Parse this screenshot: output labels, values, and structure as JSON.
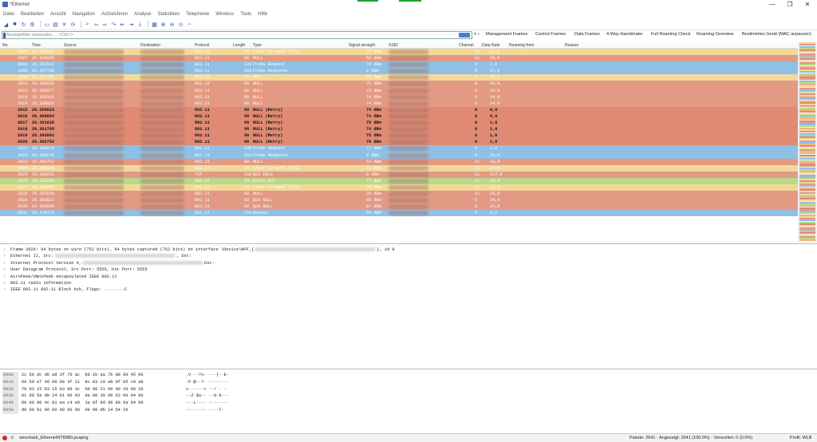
{
  "window": {
    "title": "*Ethernet",
    "minimize": "—",
    "maximize": "❐",
    "close": "✕"
  },
  "menu": [
    "Datei",
    "Bearbeiten",
    "Ansicht",
    "Navigation",
    "Aufzeichnen",
    "Analyse",
    "Statistiken",
    "Telephonie",
    "Wireless",
    "Tools",
    "Hilfe"
  ],
  "toolbar_icons": [
    "shark-fin-start-icon",
    "stop-icon",
    "restart-icon",
    "options-gear-icon",
    "open-file-icon",
    "save-icon",
    "close-file-icon",
    "reload-icon",
    "find-icon",
    "back-arrow-icon",
    "forward-arrow-icon",
    "goto-packet-icon",
    "first-packet-icon",
    "last-packet-icon",
    "autoscroll-icon",
    "colorize-icon",
    "zoom-in-icon",
    "zoom-out-icon",
    "zoom-normal-icon",
    "resize-columns-icon"
  ],
  "filter": {
    "placeholder": "Anzeigefilter anwenden … <Ctrl-/>",
    "buttons": [
      "Management Frames",
      "Control Frames",
      "Data Frames",
      "4-Way-Handshake",
      "Full Roaming Check",
      "Roaming Overview",
      "Bestimmtes Gerät (MAC anpassen)"
    ]
  },
  "columns": [
    "No.",
    "Time",
    "Source",
    "Destination",
    "Protocol",
    "Length",
    "Type",
    "Signal strength",
    "SSID",
    "Channel",
    "Data Rate",
    "Roaming from",
    "Reason"
  ],
  "colors": {
    "yellow": "#f2d99a",
    "salmon": "#e39a84",
    "blue": "#8fc0e6",
    "green": "#b9d98a",
    "orange": "#f0b483",
    "dark_salmon": "#e08a74"
  },
  "packets": [
    {
      "no": "2006",
      "time": "26.338021",
      "proto": "802.11",
      "len": "70",
      "type": "Clear-to-send (CTS)",
      "sig": "77 dBm",
      "ch": "11",
      "rate": "11,0",
      "color": "#f2d99a",
      "bold": false
    },
    {
      "no": "2007",
      "time": "26.338025",
      "proto": "802.11",
      "len": "90",
      "type": "NULL",
      "sig": "52 dBm",
      "ch": "11",
      "rate": "18,0",
      "color": "#e39a84",
      "bold": false
    },
    {
      "no": "2008",
      "time": "26.357614",
      "proto": "802.11",
      "len": "231",
      "type": "Probe Request",
      "sig": "76 dBm",
      "ch": "6",
      "rate": "1,0",
      "color": "#8fc0e6",
      "bold": false
    },
    {
      "no": "2009",
      "time": "26.357798",
      "proto": "802.11",
      "len": "203",
      "type": "Probe Response",
      "sig": "0 dBm",
      "ch": "6",
      "rate": "24,0",
      "color": "#8fc0e6",
      "bold": false
    },
    {
      "no": "2010",
      "time": "26.357798",
      "proto": "802.11",
      "len": "76",
      "type": "ACK",
      "sig": "75 dBm",
      "ch": "6",
      "rate": "24,0",
      "color": "#f2d99a",
      "bold": false
    },
    {
      "no": "2011",
      "time": "26.358029",
      "proto": "802.11",
      "len": "90",
      "type": "NULL",
      "sig": "75 dBm",
      "ch": "6",
      "rate": "24,0",
      "color": "#e39a84",
      "bold": false
    },
    {
      "no": "2012",
      "time": "26.358077",
      "proto": "802.11",
      "len": "90",
      "type": "NULL",
      "sig": "73 dBm",
      "ch": "6",
      "rate": "24,0",
      "color": "#e39a84",
      "bold": false
    },
    {
      "no": "2013",
      "time": "26.358161",
      "proto": "802.11",
      "len": "90",
      "type": "NULL",
      "sig": "74 dBm",
      "ch": "6",
      "rate": "24,0",
      "color": "#e39a84",
      "bold": false
    },
    {
      "no": "2014",
      "time": "26.358023",
      "proto": "802.11",
      "len": "90",
      "type": "NULL",
      "sig": "74 dBm",
      "ch": "6",
      "rate": "24,0",
      "color": "#e39a84",
      "bold": false
    },
    {
      "no": "2015",
      "time": "26.359023",
      "proto": "802.11",
      "len": "90",
      "type": "NULL (Retry)",
      "sig": "74 dBm",
      "ch": "6",
      "rate": "6,0",
      "color": "#e08a74",
      "bold": true
    },
    {
      "no": "2016",
      "time": "26.360054",
      "proto": "802.11",
      "len": "90",
      "type": "NULL (Retry)",
      "sig": "74 dBm",
      "ch": "6",
      "rate": "6,0",
      "color": "#e08a74",
      "bold": true
    },
    {
      "no": "2017",
      "time": "26.361618",
      "proto": "802.11",
      "len": "90",
      "type": "NULL (Retry)",
      "sig": "75 dBm",
      "ch": "6",
      "rate": "1,0",
      "color": "#e08a74",
      "bold": true
    },
    {
      "no": "2018",
      "time": "26.361709",
      "proto": "802.11",
      "len": "90",
      "type": "NULL (Retry)",
      "sig": "74 dBm",
      "ch": "6",
      "rate": "1,0",
      "color": "#e08a74",
      "bold": true
    },
    {
      "no": "2019",
      "time": "26.362091",
      "proto": "802.11",
      "len": "90",
      "type": "NULL (Retry)",
      "sig": "75 dBm",
      "ch": "6",
      "rate": "1,0",
      "color": "#e08a74",
      "bold": true
    },
    {
      "no": "2020",
      "time": "26.362752",
      "proto": "802.11",
      "len": "90",
      "type": "NULL (Retry)",
      "sig": "76 dBm",
      "ch": "6",
      "rate": "1,0",
      "color": "#e08a74",
      "bold": true
    },
    {
      "no": "2021",
      "time": "26.368678",
      "proto": "802.11",
      "len": "235",
      "type": "Probe Request",
      "sig": "77 dBm",
      "ch": "6",
      "rate": "1,0",
      "color": "#8fc0e6",
      "bold": false
    },
    {
      "no": "2022",
      "time": "26.368678",
      "proto": "802.11",
      "len": "203",
      "type": "Probe Response",
      "sig": "0 dBm",
      "ch": "6",
      "rate": "24,0",
      "color": "#8fc0e6",
      "bold": false
    },
    {
      "no": "2023",
      "time": "26.382753",
      "proto": "802.11",
      "len": "90",
      "type": "NULL",
      "sig": "53 dBm",
      "ch": "11",
      "rate": "18,0",
      "color": "#e39a84",
      "bold": false
    },
    {
      "no": "2024",
      "time": "26.383144",
      "proto": "802.11",
      "len": "70",
      "type": "Clear-to-send (CTS)",
      "sig": "72 dBm",
      "ch": "11",
      "rate": "24,0",
      "color": "#f2d99a",
      "bold": false
    },
    {
      "no": "2025",
      "time": "26.383231",
      "proto": "TCP",
      "len": "152",
      "type": "QoS Data",
      "sig": "0 dBm",
      "ch": "11",
      "rate": "117,0",
      "color": "#e39a84",
      "bold": false
    },
    {
      "no": "2026",
      "time": "26.383303",
      "proto": "802.11",
      "len": "94",
      "type": "Block Ack",
      "sig": "77 dBm",
      "ch": "11",
      "rate": "24,0",
      "color": "#b9d98a",
      "bold": false
    },
    {
      "no": "2027",
      "time": "26.383465",
      "proto": "802.11",
      "len": "70",
      "type": "Clear-to-send (CTS)",
      "sig": "75 dBm",
      "ch": "11",
      "rate": "12,0",
      "color": "#f2d99a",
      "bold": false
    },
    {
      "no": "2028",
      "time": "26.383510",
      "proto": "802.11",
      "len": "90",
      "type": "NULL",
      "sig": "34 dBm",
      "ch": "11",
      "rate": "18,0",
      "color": "#e39a84",
      "bold": false
    },
    {
      "no": "2029",
      "time": "26.385821",
      "proto": "802.11",
      "len": "92",
      "type": "QoS NULL",
      "sig": "85 dBm",
      "ch": "6",
      "rate": "24,0",
      "color": "#e39a84",
      "bold": false
    },
    {
      "no": "2030",
      "time": "26.393668",
      "proto": "802.11",
      "len": "92",
      "type": "QoS NULL",
      "sig": "87 dBm",
      "ch": "6",
      "rate": "24,0",
      "color": "#e39a84",
      "bold": false
    },
    {
      "no": "2031",
      "time": "26.419773",
      "proto": "802.11",
      "len": "353",
      "type": "Beacon",
      "sig": "84 dBm",
      "ch": "6",
      "rate": "6,0",
      "color": "#8fc0e6",
      "bold": false
    }
  ],
  "details": [
    {
      "prefix": "Frame 2026: 94 bytes on wire (752 bits), 94 bytes captured (752 bits) on interface \\Device\\NPF_{",
      "suffix": "}, id 0"
    },
    {
      "prefix": "Ethernet II, Src:",
      "suffix": ", Dst:"
    },
    {
      "prefix": "Internet Protocol Version 4,",
      "suffix": "Dst:"
    },
    {
      "prefix": "User Datagram Protocol, Src Port: 5555, Dst Port: 5555",
      "suffix": ""
    },
    {
      "prefix": "AiroPeek/OmniPeek encapsulated IEEE 802.11",
      "suffix": ""
    },
    {
      "prefix": "802.11 radio information",
      "suffix": ""
    },
    {
      "prefix": "IEEE 802.11 802.11 Block Ack, Flags: ........C",
      "suffix": ""
    }
  ],
  "hex": [
    {
      "off": "0000",
      "bytes": "2c 56 dc d6 ad 3f 76 ac  b9 1b aa 7b 08 00 45 00",
      "ascii": ",V···?v· ···{··E·"
    },
    {
      "off": "0010",
      "bytes": "00 50 e7 40 00 00 3f 11  8c 83 c0 a8 0f 05 c0 a8",
      "ascii": "·P·@··?· ········"
    },
    {
      "off": "0020",
      "bytes": "78 03 15 b3 15 b3 00 3c  00 00 21 60 00 20 00 20",
      "ascii": "x······< ··!`· ·"
    },
    {
      "off": "0030",
      "bytes": "01 00 5a d8 24 61 90 93  0a 00 30 0b 62 00 94 00",
      "ascii": "··Z·$a·· ··0·b···"
    },
    {
      "off": "0040",
      "bytes": "00 00 90 4c 81 ea c4 e0  3a 8f 9d d6 88 9a 04 00",
      "ascii": "···L···· :·······"
    },
    {
      "off": "0050",
      "bytes": "d0 00 01 00 00 00 00 00  00 00 db 14 54 1b",
      "ascii": "········ ····T·"
    }
  ],
  "status": {
    "file": "wireshark_EthernetNTIM80.pcapng",
    "counts": "Pakete: 2641 · Angezeigt: 2641 (100.0%) · Verworfen: 0 (0.0%)",
    "profile": "Profil: WLB"
  }
}
